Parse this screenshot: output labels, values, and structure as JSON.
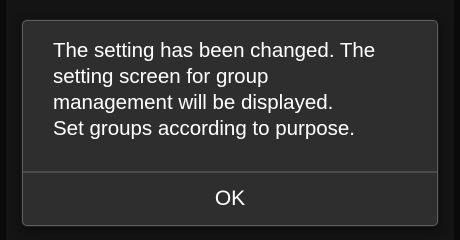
{
  "dialog": {
    "message_lines": [
      "The setting has been changed. The",
      "setting screen for group",
      "management will be displayed.",
      "Set groups according to purpose."
    ],
    "ok_label": "OK"
  },
  "colors": {
    "background": "#0a0a0a",
    "dialog_background": "#2e2e2e",
    "dialog_border": "#5e5e5e",
    "text": "#ffffff"
  }
}
